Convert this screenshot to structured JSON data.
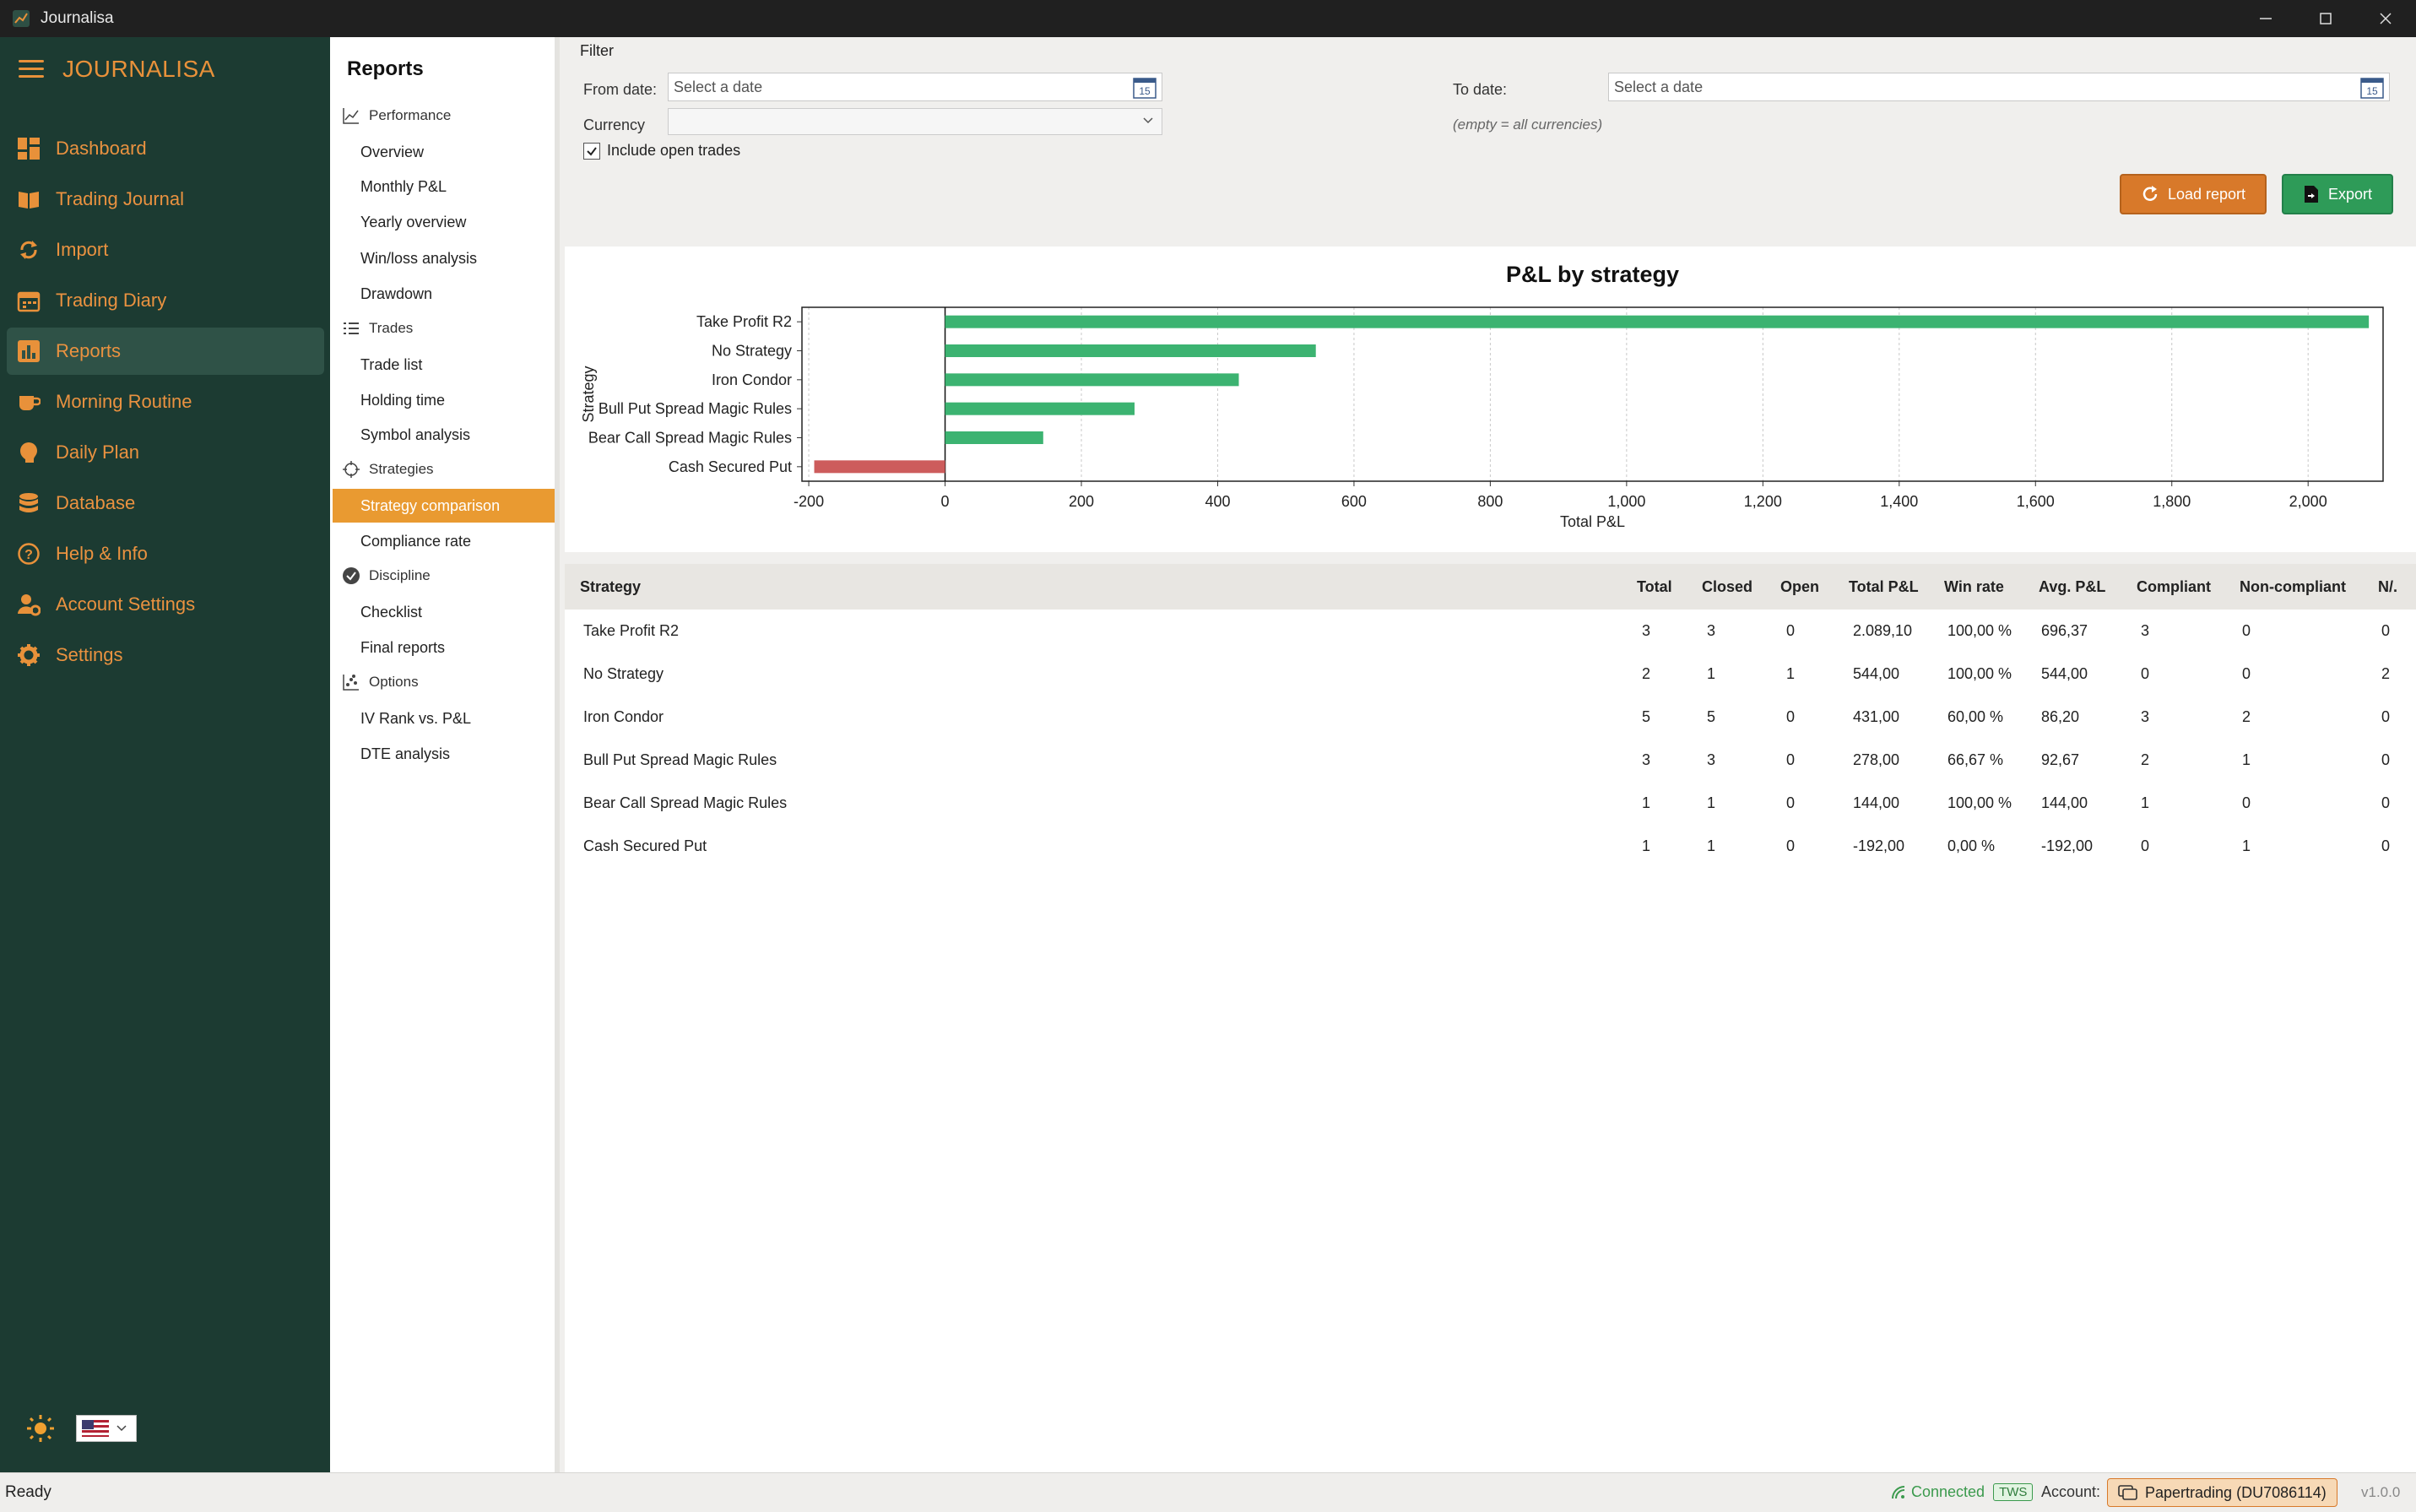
{
  "window": {
    "title": "Journalisa"
  },
  "brand": {
    "name": "JOURNALISA"
  },
  "sidebar": {
    "items": [
      {
        "label": "Dashboard",
        "icon": "dashboard-icon"
      },
      {
        "label": "Trading Journal",
        "icon": "book-icon"
      },
      {
        "label": "Import",
        "icon": "sync-icon"
      },
      {
        "label": "Trading Diary",
        "icon": "calendar-icon"
      },
      {
        "label": "Reports",
        "icon": "bar-chart-icon",
        "active": true
      },
      {
        "label": "Morning Routine",
        "icon": "coffee-icon"
      },
      {
        "label": "Daily Plan",
        "icon": "brain-icon"
      },
      {
        "label": "Database",
        "icon": "database-icon"
      },
      {
        "label": "Help & Info",
        "icon": "help-icon"
      },
      {
        "label": "Account Settings",
        "icon": "user-gear-icon"
      },
      {
        "label": "Settings",
        "icon": "gear-icon"
      }
    ],
    "accent": "#e8913a",
    "background": "#1c3b32"
  },
  "reports_nav": {
    "title": "Reports",
    "groups": [
      {
        "label": "Performance",
        "icon": "line-chart-icon",
        "items": [
          "Overview",
          "Monthly P&L",
          "Yearly overview",
          "Win/loss analysis",
          "Drawdown"
        ]
      },
      {
        "label": "Trades",
        "icon": "list-icon",
        "items": [
          "Trade list",
          "Holding time",
          "Symbol analysis"
        ]
      },
      {
        "label": "Strategies",
        "icon": "crosshair-icon",
        "items": [
          "Strategy comparison",
          "Compliance rate"
        ]
      },
      {
        "label": "Discipline",
        "icon": "check-circle-icon",
        "items": [
          "Checklist",
          "Final reports"
        ]
      },
      {
        "label": "Options",
        "icon": "scatter-icon",
        "items": [
          "IV Rank vs. P&L",
          "DTE analysis"
        ]
      }
    ],
    "active_item": "Strategy comparison"
  },
  "filter": {
    "title": "Filter",
    "from_label": "From date:",
    "from_placeholder": "Select a date",
    "to_label": "To date:",
    "to_placeholder": "Select a date",
    "currency_label": "Currency",
    "currency_value": "",
    "currency_hint": "(empty = all currencies)",
    "include_open_label": "Include open trades",
    "include_open_checked": true,
    "calendar_day": "15",
    "load_button": "Load report",
    "export_button": "Export"
  },
  "chart_data": {
    "type": "bar",
    "orientation": "horizontal",
    "title": "P&L by strategy",
    "xlabel": "Total P&L",
    "ylabel": "Strategy",
    "categories": [
      "Take Profit R2",
      "No Strategy",
      "Iron Condor",
      "Bull Put Spread Magic Rules",
      "Bear Call Spread Magic Rules",
      "Cash Secured Put"
    ],
    "values": [
      2089.1,
      544.0,
      431.0,
      278.0,
      144.0,
      -192.0
    ],
    "xlim": [
      -210,
      2110
    ],
    "xticks": [
      -200,
      0,
      200,
      400,
      600,
      800,
      1000,
      1200,
      1400,
      1600,
      1800,
      2000
    ],
    "xtick_labels": [
      "-200",
      "0",
      "200",
      "400",
      "600",
      "800",
      "1,000",
      "1,200",
      "1,400",
      "1,600",
      "1,800",
      "2,000"
    ],
    "grid": "vertical-dashed",
    "positive_color": "#3cb371",
    "negative_color": "#cd5c5c"
  },
  "table": {
    "columns": [
      "Strategy",
      "Total",
      "Closed",
      "Open",
      "Total P&L",
      "Win rate",
      "Avg. P&L",
      "Compliant",
      "Non-compliant",
      "N/."
    ],
    "rows": [
      [
        "Take Profit R2",
        "3",
        "3",
        "0",
        "2.089,10",
        "100,00 %",
        "696,37",
        "3",
        "0",
        "0"
      ],
      [
        "No Strategy",
        "2",
        "1",
        "1",
        "544,00",
        "100,00 %",
        "544,00",
        "0",
        "0",
        "2"
      ],
      [
        "Iron Condor",
        "5",
        "5",
        "0",
        "431,00",
        "60,00 %",
        "86,20",
        "3",
        "2",
        "0"
      ],
      [
        "Bull Put Spread Magic Rules",
        "3",
        "3",
        "0",
        "278,00",
        "66,67 %",
        "92,67",
        "2",
        "1",
        "0"
      ],
      [
        "Bear Call Spread Magic Rules",
        "1",
        "1",
        "0",
        "144,00",
        "100,00 %",
        "144,00",
        "1",
        "0",
        "0"
      ],
      [
        "Cash Secured Put",
        "1",
        "1",
        "0",
        "-192,00",
        "0,00 %",
        "-192,00",
        "0",
        "1",
        "0"
      ]
    ]
  },
  "status": {
    "ready": "Ready",
    "connected": "Connected",
    "tws": "TWS",
    "account_label": "Account:",
    "account": "Papertrading (DU7086114)",
    "version": "v1.0.0"
  }
}
